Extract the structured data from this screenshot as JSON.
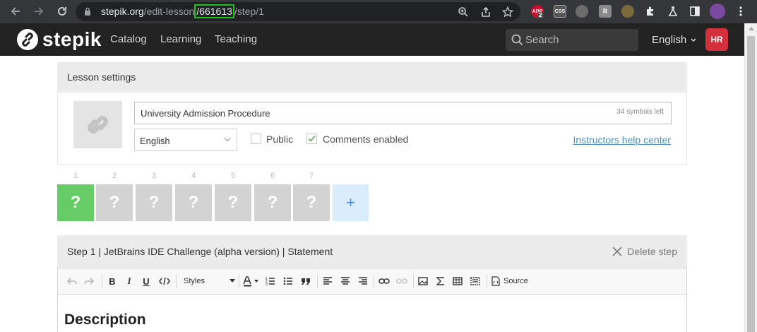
{
  "browser": {
    "url_host": "stepik.org",
    "url_path_before": "/edit-lesson",
    "url_highlight": "/661613",
    "url_path_after": "/step/1",
    "extensions": [
      {
        "name": "adblock-icon",
        "label": "ABP",
        "badge": "2",
        "color": "#c70d2c"
      },
      {
        "name": "css-viewer-icon",
        "label": "CSS",
        "color": "#555555"
      },
      {
        "name": "extension-icon-3",
        "label": "",
        "color": "#6d6d6d"
      },
      {
        "name": "extension-icon-4",
        "label": "R",
        "color": "#8a8a8a"
      },
      {
        "name": "extension-icon-5",
        "label": "",
        "color": "#7a6a3a"
      },
      {
        "name": "extensions-puzzle-icon",
        "label": "",
        "color": "#35363a"
      },
      {
        "name": "labs-flask-icon",
        "label": "",
        "color": "#35363a"
      },
      {
        "name": "sidebar-icon",
        "label": "",
        "color": "#35363a"
      },
      {
        "name": "profile-avatar-icon",
        "label": "",
        "color": "#7b4aa0"
      }
    ]
  },
  "header": {
    "brand": "stepik",
    "nav": [
      "Catalog",
      "Learning",
      "Teaching"
    ],
    "search_placeholder": "Search",
    "language": "English",
    "avatar_initials": "HR",
    "avatar_color": "#d32f3c"
  },
  "lesson_settings": {
    "heading": "Lesson settings",
    "title_value": "University Admission Procedure",
    "title_counter": "34 symbols left",
    "language_value": "English",
    "public_label": "Public",
    "public_checked": false,
    "comments_label": "Comments enabled",
    "comments_checked": true,
    "help_link": "Instructors help center"
  },
  "steps": {
    "items": [
      {
        "number": "1",
        "mark": "?",
        "active": true
      },
      {
        "number": "2",
        "mark": "?",
        "active": false
      },
      {
        "number": "3",
        "mark": "?",
        "active": false
      },
      {
        "number": "4",
        "mark": "?",
        "active": false
      },
      {
        "number": "5",
        "mark": "?",
        "active": false
      },
      {
        "number": "6",
        "mark": "?",
        "active": false
      },
      {
        "number": "7",
        "mark": "?",
        "active": false
      }
    ],
    "add_label": "+"
  },
  "step_editor": {
    "title": "Step 1 | JetBrains IDE Challenge (alpha version) | Statement",
    "delete_label": "Delete step",
    "toolbar": {
      "bold": "B",
      "italic": "I",
      "underline": "U",
      "styles_label": "Styles",
      "source_label": "Source"
    },
    "content_heading": "Description"
  }
}
